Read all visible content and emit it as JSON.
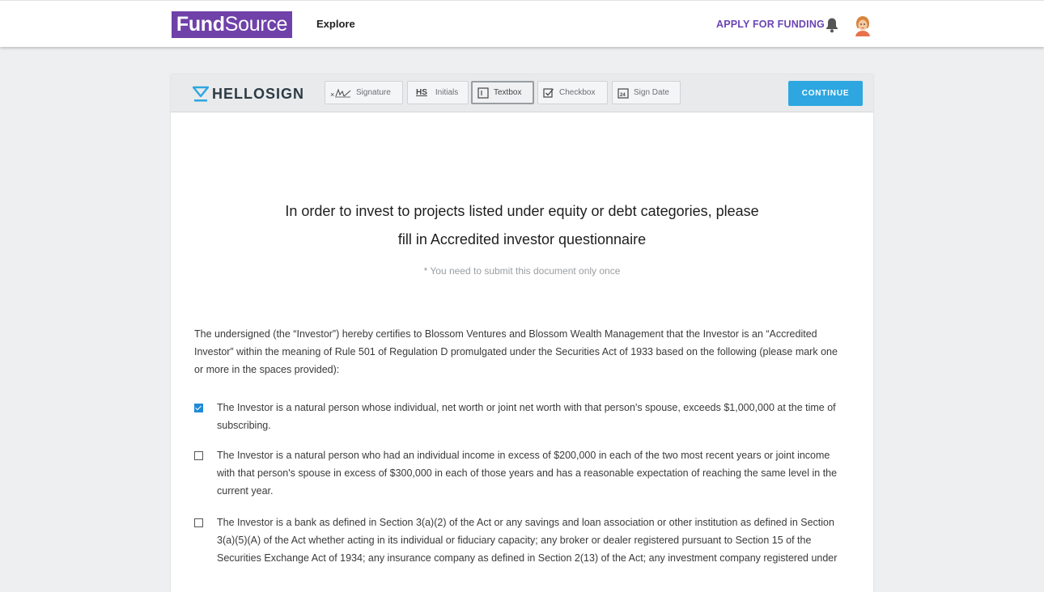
{
  "nav": {
    "logo_bold": "Fund",
    "logo_light": "Source",
    "explore_label": "Explore",
    "apply_label": "APPLY FOR FUNDING",
    "bell_icon": "bell-icon",
    "avatar": "user-avatar"
  },
  "toolbar": {
    "brand": "HELLOSIGN",
    "tools": [
      {
        "label": "Signature",
        "icon": "signature-icon"
      },
      {
        "label": "Initials",
        "icon": "initials-icon",
        "icon_text": "HS"
      },
      {
        "label": "Textbox",
        "icon": "textbox-icon",
        "active": true
      },
      {
        "label": "Checkbox",
        "icon": "checkbox-icon"
      },
      {
        "label": "Sign Date",
        "icon": "calendar-icon",
        "icon_text": "24"
      }
    ],
    "continue_label": "CONTINUE"
  },
  "document": {
    "headline_line1": "In order to invest to projects listed under equity or debt categories, please",
    "headline_line2": "fill in Accredited investor questionnaire",
    "note": "* You need to submit this document only once",
    "intro": "The undersigned (the “Investor”) hereby certifies to Blossom Ventures and Blossom Wealth Management that the Investor is an “Accredited Investor” within the meaning of Rule 501 of Regulation D promulgated under the Securities Act of 1933 based on the following (please mark one or more in the spaces provided):",
    "items": [
      {
        "checked": true,
        "text": "The Investor is a natural person whose individual, net worth or joint net worth with  that person's spouse, exceeds $1,000,000 at the time of subscribing."
      },
      {
        "checked": false,
        "text": "The Investor is a natural person who had an individual income in excess of $200,000 in each of the two most recent years or joint income with that person's spouse in excess of $300,000 in each of those years and has a reasonable expectation of reaching the same level in the current year."
      },
      {
        "checked": false,
        "text": "The Investor is a bank as defined in Section 3(a)(2) of the Act or any savings and loan association or other institution as defined in Section 3(a)(5)(A) of the Act whether acting in its individual or fiduciary capacity; any broker or dealer registered pursuant to Section 15 of the Securities Exchange Act of 1934; any insurance company as defined in Section 2(13) of the Act; any investment company registered under"
      }
    ]
  },
  "colors": {
    "brand_purple": "#6f41a9",
    "accent_blue": "#2ea7e0",
    "checkbox_blue": "#1f8ad8"
  }
}
